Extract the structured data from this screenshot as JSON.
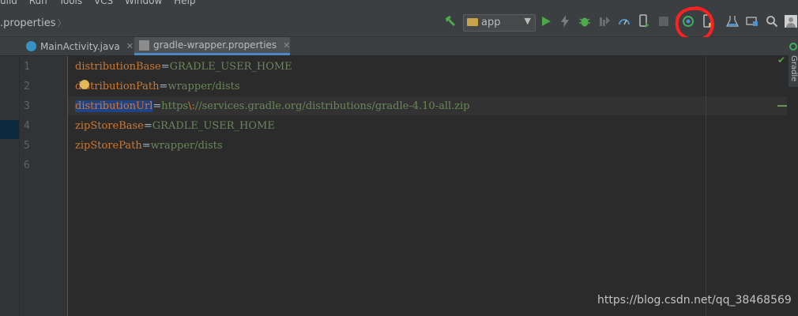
{
  "menu": [
    "uild",
    "Run",
    "Tools",
    "VCS",
    "Window",
    "Help"
  ],
  "breadcrumb": {
    "label": ".properties",
    "separator": "〉"
  },
  "run_config": {
    "value": "app"
  },
  "tabs": [
    {
      "label": "MainActivity.java",
      "icon": "class-c-icon",
      "active": false
    },
    {
      "label": "gradle-wrapper.properties",
      "icon": "properties-file-icon",
      "active": true
    }
  ],
  "editor": {
    "line_numbers": [
      "1",
      "2",
      "3",
      "4",
      "5",
      "6"
    ],
    "lines": [
      {
        "key": "distributionBase",
        "eq": "=",
        "value": "GRADLE_USER_HOME"
      },
      {
        "key": "distributionPath",
        "eq": "=",
        "value": "wrapper/dists"
      },
      {
        "key": "distributionUrl",
        "eq": "=",
        "value_a": "https",
        "escape": "\\:",
        "value_b": "//services.gradle.org/distributions/gradle-4.10-all.zip"
      },
      {
        "key": "zipStoreBase",
        "eq": "=",
        "value": "GRADLE_USER_HOME"
      },
      {
        "key": "zipStorePath",
        "eq": "=",
        "value": "wrapper/dists"
      }
    ]
  },
  "side_tool": {
    "label": "Gradle"
  },
  "watermark": "https://blog.csdn.net/qq_38468569",
  "colors": {
    "background": "#2b2b2b",
    "toolbar": "#3c3f41",
    "keyword": "#cc7832",
    "string": "#6a8759",
    "selection": "#214283",
    "annotation": "#ff2020"
  },
  "toolbar_icons": [
    "build-hammer-icon",
    "run-config-folder-icon",
    "run-icon",
    "apply-changes-icon",
    "debug-icon",
    "coverage-icon",
    "profile-icon",
    "attach-debugger-icon",
    "stop-icon",
    "sync-gradle-icon",
    "avd-manager-icon",
    "sdk-manager-icon",
    "project-structure-icon",
    "search-icon",
    "user-avatar-icon"
  ]
}
